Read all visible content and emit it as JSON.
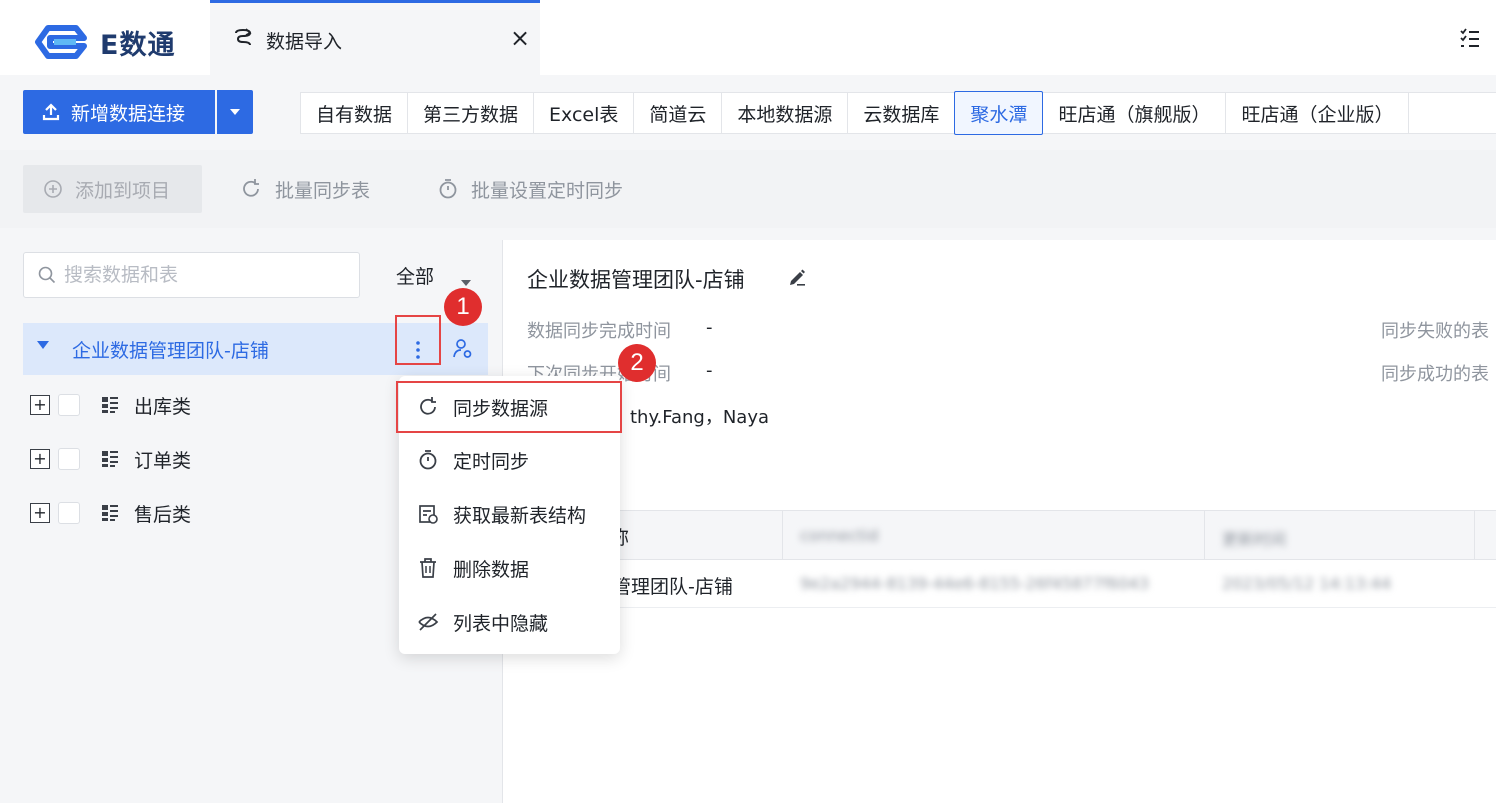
{
  "app": {
    "logo_text": "E数通"
  },
  "tab": {
    "label": "数据导入",
    "close": "×"
  },
  "toolbar": {
    "add_connection": "新增数据连接"
  },
  "source_tabs": [
    "自有数据",
    "第三方数据",
    "Excel表",
    "简道云",
    "本地数据源",
    "云数据库",
    "聚水潭",
    "旺店通（旗舰版）",
    "旺店通（企业版）"
  ],
  "active_source": "聚水潭",
  "actions": {
    "add_to_project": "添加到项目",
    "batch_sync": "批量同步表",
    "batch_schedule": "批量设置定时同步"
  },
  "search": {
    "placeholder": "搜索数据和表"
  },
  "filter": {
    "label": "全部"
  },
  "tree": {
    "group": "企业数据管理团队-店铺",
    "items": [
      "出库类",
      "订单类",
      "售后类"
    ]
  },
  "detail": {
    "title": "企业数据管理团队-店铺",
    "sync_done_label": "数据同步完成时间",
    "sync_done_value": "-",
    "next_sync_label": "下次同步开始时间",
    "next_sync_value": "-",
    "failed_label": "同步失败的表",
    "success_label": "同步成功的表",
    "members_value": "thy.Fang，Naya"
  },
  "table": {
    "head_name": "称",
    "head_col2": "connectid",
    "head_col3": "更新时间",
    "row_name": "据管理团队-店铺",
    "row_col2": "9e2a2944-8139-44e6-8155-26f45877f6043",
    "row_col3": "2023/05/12 14:13:44"
  },
  "popup_menu": [
    "同步数据源",
    "定时同步",
    "获取最新表结构",
    "删除数据",
    "列表中隐藏"
  ],
  "badges": [
    "1",
    "2"
  ],
  "colors": {
    "primary": "#2d6ae3",
    "highlight": "#e54545",
    "badge": "#e02e2e"
  }
}
